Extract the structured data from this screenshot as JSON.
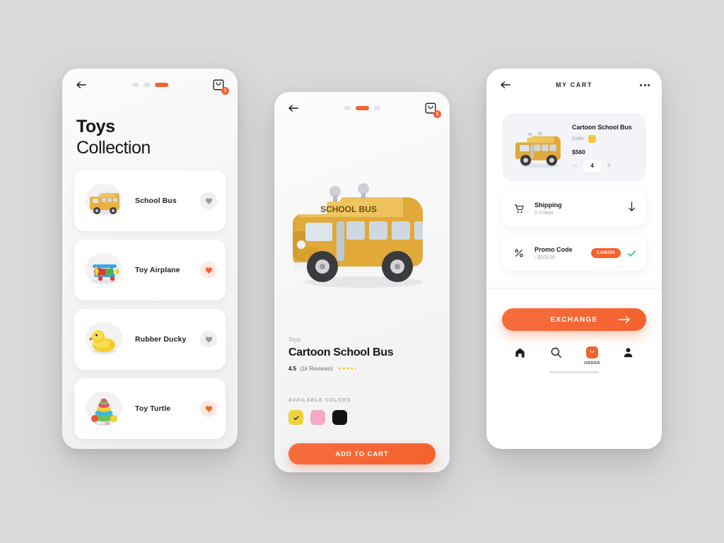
{
  "app": {
    "accent": "#f4622e",
    "background": "#d9d9d9"
  },
  "list_screen": {
    "back_icon": "arrow-left-icon",
    "pager": {
      "total": 3,
      "active_index": 2
    },
    "cart_icon": "shopping-bag-icon",
    "cart_badge": "1",
    "title_line1": "Toys",
    "title_line2": "Collection",
    "items": [
      {
        "name": "School Bus",
        "icon": "school-bus-toy-icon",
        "liked": false
      },
      {
        "name": "Toy Airplane",
        "icon": "airplane-toy-icon",
        "liked": true
      },
      {
        "name": "Rubber Ducky",
        "icon": "rubber-duck-toy-icon",
        "liked": false
      },
      {
        "name": "Toy Turtle",
        "icon": "stacking-rings-toy-icon",
        "liked": true
      }
    ]
  },
  "detail_screen": {
    "back_icon": "arrow-left-icon",
    "pager": {
      "total": 3,
      "active_index": 1
    },
    "cart_icon": "shopping-bag-icon",
    "cart_badge": "1",
    "hero_icon": "school-bus-3d-icon",
    "category": "Toys",
    "product_title": "Cartoon School Bus",
    "rating_value": "4.5",
    "review_count": "(1k Reviews)",
    "stars_filled": 4,
    "stars_total": 5,
    "colors_label": "AVAILABLE COLORS",
    "colors": [
      {
        "name": "yellow",
        "hex": "#efd23c",
        "selected": true
      },
      {
        "name": "pink",
        "hex": "#f4a9c4",
        "selected": false
      },
      {
        "name": "black",
        "hex": "#131316",
        "selected": false
      }
    ],
    "cta_label": "ADD TO CART"
  },
  "cart_screen": {
    "back_icon": "arrow-left-icon",
    "title": "MY CART",
    "more_icon": "more-horizontal-icon",
    "item": {
      "thumb_icon": "school-bus-3d-icon",
      "name": "Cartoon School Bus",
      "color_label": "Color",
      "color_hex": "#f5c83c",
      "price": "$560",
      "decrement": "–",
      "quantity": "4",
      "increment": "+"
    },
    "rows": [
      {
        "icon": "shopping-cart-icon",
        "title": "Shipping",
        "subtitle": "2-3 days",
        "action_icon": "arrow-down-icon"
      },
      {
        "icon": "percent-icon",
        "title": "Promo Code",
        "subtitle": "- $100.00",
        "badge": "CAM256",
        "action_icon": "check-icon"
      }
    ],
    "exchange_label": "EXCHANGE",
    "exchange_arrow_icon": "arrow-right-icon",
    "tabs": [
      {
        "icon": "home-icon",
        "label": "",
        "active": false
      },
      {
        "icon": "search-icon",
        "label": "",
        "active": false
      },
      {
        "icon": "bag-icon",
        "label": "ORDER",
        "active": true
      },
      {
        "icon": "person-icon",
        "label": "",
        "active": false
      }
    ]
  }
}
